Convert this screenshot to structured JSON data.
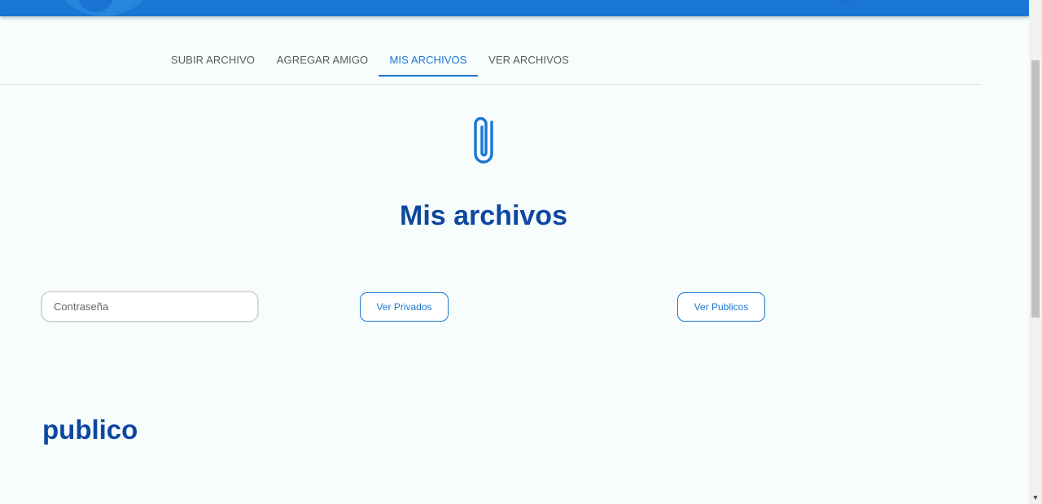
{
  "tabs": [
    {
      "label": "SUBIR ARCHIVO",
      "active": false
    },
    {
      "label": "AGREGAR AMIGO",
      "active": false
    },
    {
      "label": "MIS ARCHIVOS",
      "active": true
    },
    {
      "label": "VER ARCHIVOS",
      "active": false
    }
  ],
  "main": {
    "icon": "paperclip-icon",
    "title": "Mis archivos",
    "password_placeholder": "Contraseña",
    "password_value": "",
    "private_button": "Ver Privados",
    "public_button": "Ver Publicos",
    "section_title": "publico"
  },
  "colors": {
    "primary": "#1976d2",
    "title": "#0d47a1",
    "background": "#f7fdfd"
  },
  "scrollbar": {
    "down_icon": "chevron-down-icon"
  }
}
